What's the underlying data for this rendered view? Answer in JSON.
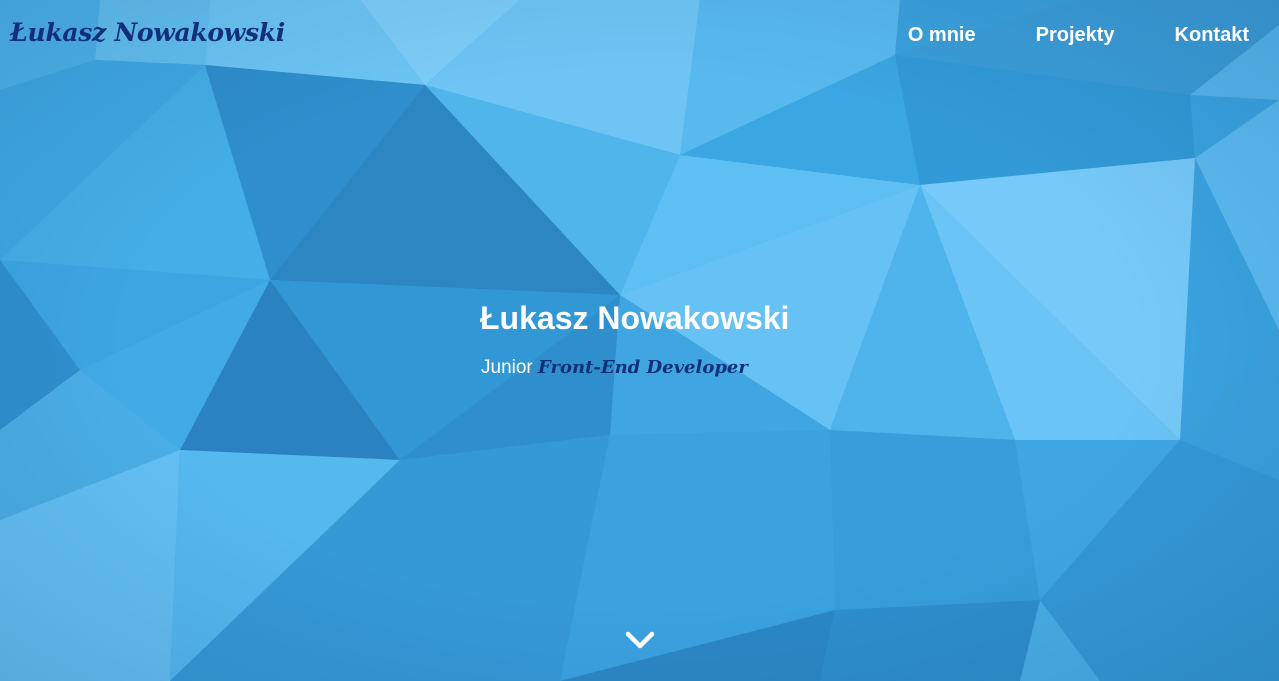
{
  "header": {
    "logo_text": "Łukasz Nowakowski",
    "nav": [
      {
        "label": "O mnie"
      },
      {
        "label": "Projekty"
      },
      {
        "label": "Kontakt"
      }
    ]
  },
  "hero": {
    "title": "Łukasz Nowakowski",
    "subtitle_prefix": "Junior",
    "subtitle_role": "Front-End Developer",
    "scroll_icon": "chevron-down-icon"
  },
  "colors": {
    "logo": "#12307a",
    "nav_text": "#ffffff",
    "background": "#3aa3e0"
  }
}
